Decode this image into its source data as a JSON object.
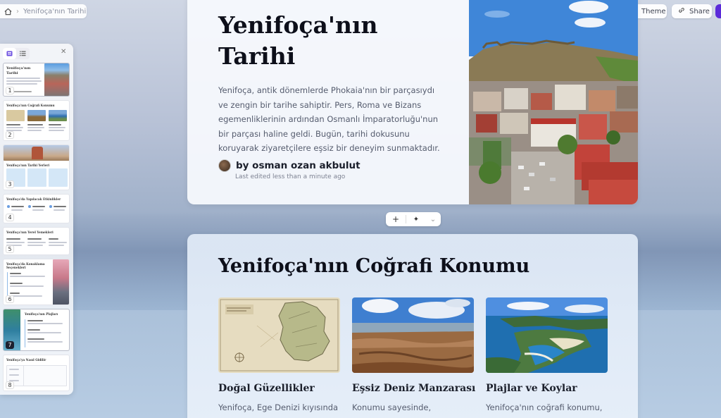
{
  "breadcrumb": {
    "current": "Yenifoça'nın Tarihi"
  },
  "toolbar": {
    "theme_label": "Theme",
    "share_label": "Share"
  },
  "thumbnails": [
    {
      "num": "1",
      "title": "Yenifoça'nın Tarihi"
    },
    {
      "num": "2",
      "title": "Yenifoça'nın Coğrafi Konumu"
    },
    {
      "num": "3",
      "title": "Yenifoça'nın Tarihi Yerleri"
    },
    {
      "num": "4",
      "title": "Yenifoça'da Yapılacak Etkinlikler"
    },
    {
      "num": "5",
      "title": "Yenifoça'nın Yerel Yemekleri"
    },
    {
      "num": "6",
      "title": "Yenifoça'da Konaklama Seçenekleri"
    },
    {
      "num": "7",
      "title": "Yenifoça'nın Plajları"
    },
    {
      "num": "8",
      "title": "Yenifoça'ya Nasıl Gidilir"
    }
  ],
  "slide1": {
    "title": "Yenifoça'nın Tarihi",
    "body": "Yenifoça, antik dönemlerde Phokaia'nın bir parçasıydı ve zengin bir tarihe sahiptir. Pers, Roma ve Bizans egemenliklerinin ardından Osmanlı İmparatorluğu'nun bir parçası haline geldi. Bugün, tarihi dokusunu koruyarak ziyaretçilere eşsiz bir deneyim sunmaktadır.",
    "author": "by osman ozan akbulut",
    "edited": "Last edited less than a minute ago"
  },
  "floating_toolbar": {
    "add": "+",
    "ai": "✦",
    "more": "⌄"
  },
  "slide2": {
    "title": "Yenifoça'nın Coğrafi Konumu",
    "features": [
      {
        "title": "Doğal Güzellikler",
        "body": "Yenifoça, Ege Denizi kıyısında"
      },
      {
        "title": "Eşsiz Deniz Manzarası",
        "body": "Konumu sayesinde,"
      },
      {
        "title": "Plajlar ve Koylar",
        "body": "Yenifoça'nın coğrafi konumu,"
      }
    ]
  },
  "icons": {
    "home": "home-icon",
    "chevron": "chevron-right-icon",
    "theme": "palette-icon",
    "share": "link-icon",
    "close": "close-icon"
  },
  "colors": {
    "accent": "#5b2bd9",
    "title": "#0d0f1a",
    "body": "#555c6e"
  }
}
